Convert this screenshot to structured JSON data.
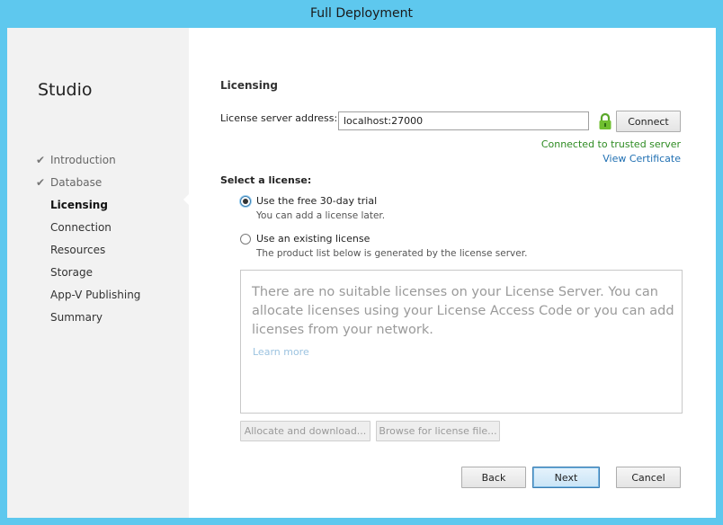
{
  "window": {
    "title": "Full Deployment"
  },
  "sidebar": {
    "title": "Studio",
    "steps": [
      {
        "label": "Introduction",
        "state": "done"
      },
      {
        "label": "Database",
        "state": "done"
      },
      {
        "label": "Licensing",
        "state": "current"
      },
      {
        "label": "Connection",
        "state": "pending"
      },
      {
        "label": "Resources",
        "state": "pending"
      },
      {
        "label": "Storage",
        "state": "pending"
      },
      {
        "label": "App-V Publishing",
        "state": "pending"
      },
      {
        "label": "Summary",
        "state": "pending"
      }
    ]
  },
  "main": {
    "heading": "Licensing",
    "server_label": "License server address:",
    "server_value": "localhost:27000",
    "connect_label": "Connect",
    "status_text": "Connected to trusted server",
    "view_certificate": "View Certificate",
    "select_label": "Select a license:",
    "option_trial": {
      "label": "Use the free 30-day trial",
      "sub": "You can add a license later.",
      "selected": true
    },
    "option_existing": {
      "label": "Use an existing license",
      "sub": "The product list below is generated by the license server.",
      "selected": false
    },
    "empty_message": "There are no suitable licenses on your License Server. You can allocate licenses using your License Access Code or you can add licenses from your network.",
    "learn_more": "Learn more",
    "allocate_label": "Allocate and download...",
    "browse_label": "Browse for license file..."
  },
  "footer": {
    "back": "Back",
    "next": "Next",
    "cancel": "Cancel"
  },
  "colors": {
    "titlebar": "#5ec8ee",
    "status_ok": "#2e8b22",
    "link": "#1f6fb2",
    "lock": "#6fbf2f"
  }
}
